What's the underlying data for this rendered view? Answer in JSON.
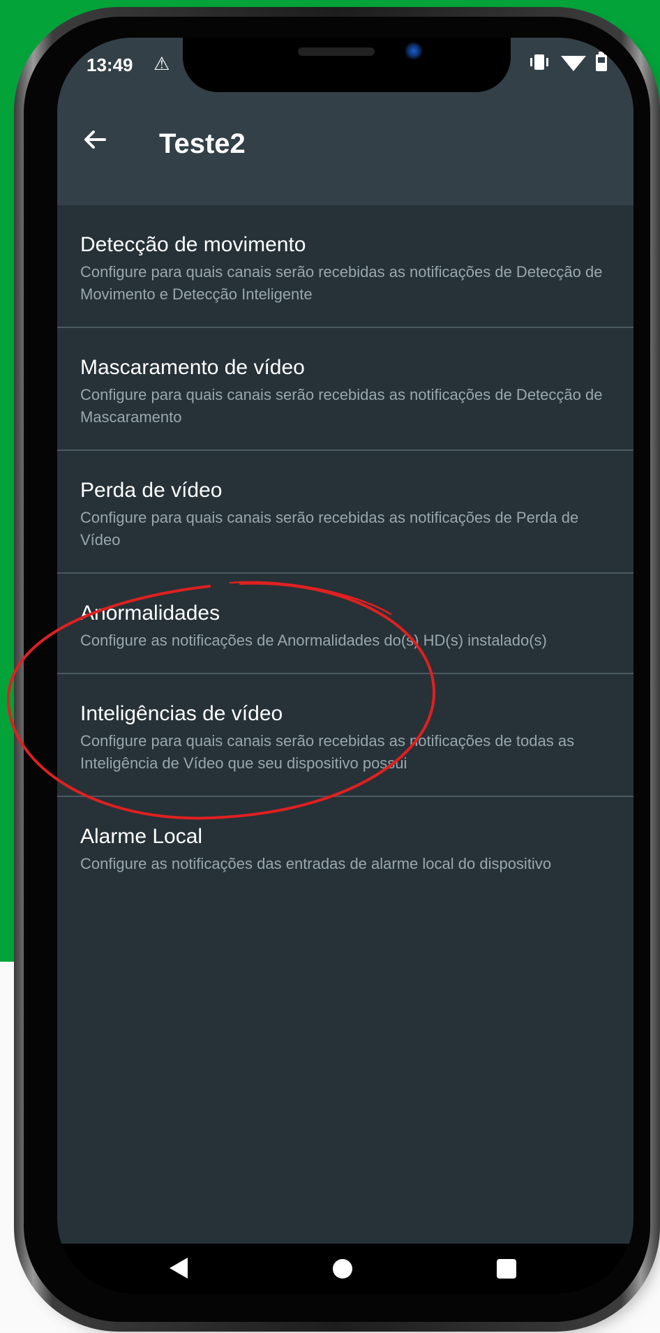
{
  "colors": {
    "background_green": "#03a33a",
    "app_background": "#263238",
    "app_bar": "#334047",
    "annotation_red": "#e02020"
  },
  "status_bar": {
    "time": "13:49",
    "warning_icon": "warning-triangle-icon",
    "right_icons": [
      "vibrate-icon",
      "wifi-icon",
      "battery-icon"
    ]
  },
  "toolbar": {
    "back_icon": "arrow-left-icon",
    "title": "Teste2"
  },
  "items": [
    {
      "title": "Detecção de movimento",
      "description": "Configure para quais canais serão recebidas as notificações de Detecção de Movimento e Detecção Inteligente"
    },
    {
      "title": "Mascaramento de vídeo",
      "description": "Configure para quais canais serão recebidas as notificações de Detecção de Mascaramento"
    },
    {
      "title": "Perda de vídeo",
      "description": "Configure para quais canais serão recebidas as notificações de Perda de Vídeo"
    },
    {
      "title": "Anormalidades",
      "description": "Configure as notificações de Anormalidades do(s) HD(s) instalado(s)"
    },
    {
      "title": "Inteligências de vídeo",
      "description": "Configure para quais canais serão recebidas as notificações de todas as Inteligência de Vídeo que seu dispositivo possui"
    },
    {
      "title": "Alarme Local",
      "description": "Configure as notificações das entradas de alarme local do dispositivo"
    }
  ],
  "nav_bar": {
    "icons": [
      "nav-back-icon",
      "nav-home-icon",
      "nav-recents-icon"
    ]
  }
}
